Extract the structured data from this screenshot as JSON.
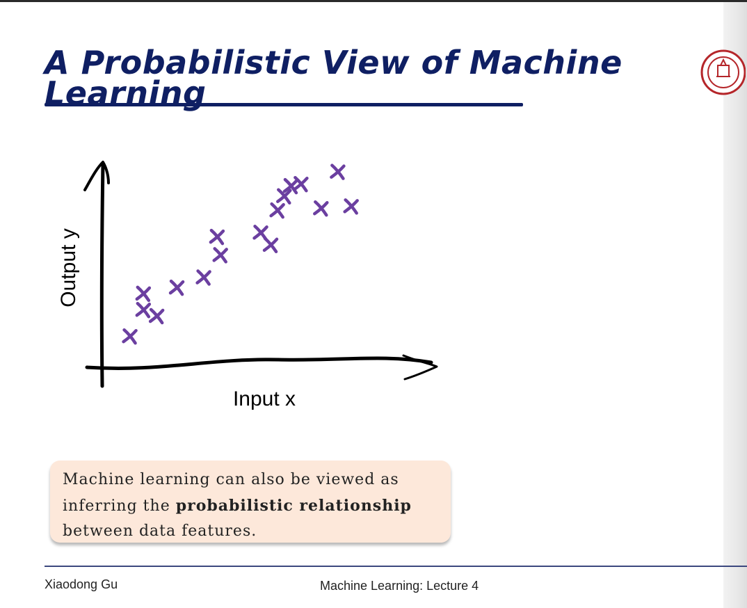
{
  "slide": {
    "title": "A Probabilistic View of Machine Learning",
    "callout": {
      "part1": "Machine learning can also be viewed as inferring the ",
      "bold1": "probabilistic relationship",
      "part2": " between data features."
    },
    "footer": {
      "author": "Xiaodong Gu",
      "course": "Machine Learning: Lecture 4"
    },
    "colors": {
      "title": "#0f1f63",
      "points": "#6b3fa0",
      "callout_bg": "#fde8da"
    },
    "logo": {
      "icon": "university-seal-icon"
    }
  },
  "chart_data": {
    "type": "scatter",
    "title": "",
    "xlabel": "Input x",
    "ylabel": "Output y",
    "grid": false,
    "xlim": [
      0,
      10
    ],
    "ylim": [
      0,
      10
    ],
    "series": [
      {
        "name": "",
        "x": [
          0.8,
          1.2,
          1.6,
          1.2,
          2.2,
          3.0,
          3.4,
          3.5,
          4.7,
          5.0,
          5.2,
          5.6,
          5.4,
          5.9,
          6.5,
          7.0,
          7.4
        ],
        "y": [
          1.5,
          2.8,
          2.5,
          3.6,
          3.9,
          4.4,
          6.4,
          5.5,
          6.6,
          6.0,
          7.7,
          8.9,
          8.4,
          9.0,
          7.8,
          9.6,
          7.9
        ]
      }
    ]
  }
}
